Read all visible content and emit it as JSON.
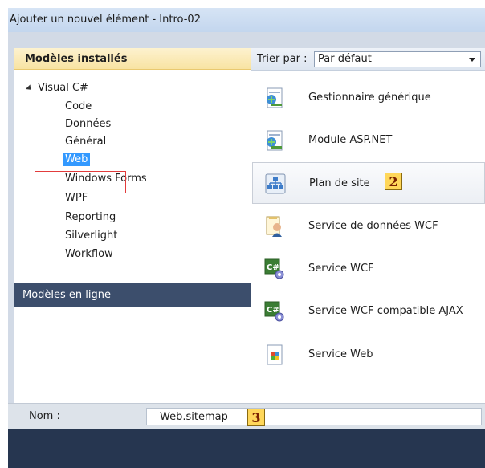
{
  "window": {
    "title": "Ajouter un nouvel élément - Intro-02"
  },
  "left_panel": {
    "header": "Modèles installés",
    "tree_root": "Visual C#",
    "categories": [
      {
        "label": "Code"
      },
      {
        "label": "Données"
      },
      {
        "label": "Général"
      },
      {
        "label": "Web",
        "selected": true
      },
      {
        "label": "Windows Forms"
      },
      {
        "label": "WPF"
      },
      {
        "label": "Reporting"
      },
      {
        "label": "Silverlight"
      },
      {
        "label": "Workflow"
      }
    ],
    "online_header": "Modèles en ligne"
  },
  "sort": {
    "label": "Trier par :",
    "value": "Par défaut"
  },
  "templates": [
    {
      "label": "Gestionnaire générique",
      "icon": "generic-handler-icon"
    },
    {
      "label": "Module ASP.NET",
      "icon": "aspnet-module-icon"
    },
    {
      "label": "Plan de site",
      "icon": "sitemap-icon",
      "selected": true
    },
    {
      "label": "Service de données WCF",
      "icon": "wcf-data-service-icon"
    },
    {
      "label": "Service WCF",
      "icon": "wcf-service-icon"
    },
    {
      "label": "Service WCF compatible AJAX",
      "icon": "ajax-wcf-service-icon"
    },
    {
      "label": "Service Web",
      "icon": "web-service-icon"
    }
  ],
  "name_field": {
    "label": "Nom :",
    "value": "Web.sitemap"
  },
  "annotations": {
    "step2": "2",
    "step3": "3"
  }
}
